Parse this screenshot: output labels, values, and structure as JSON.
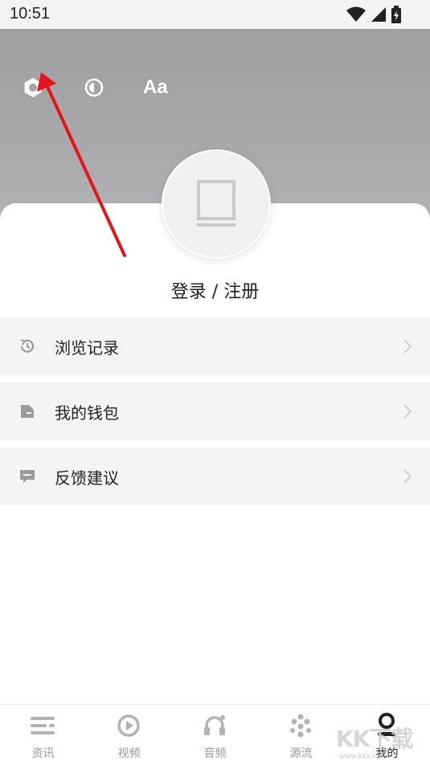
{
  "status_bar": {
    "time": "10:51",
    "icons": [
      "wifi-icon",
      "signal-icon",
      "battery-icon"
    ]
  },
  "header": {
    "icons": [
      "settings-icon",
      "theme-toggle-icon"
    ],
    "font_size_label": "Aa",
    "background_color": "#a4a4a6"
  },
  "profile": {
    "login_label": "登录 / 注册",
    "avatar_icon": "book-icon"
  },
  "menu": {
    "items": [
      {
        "label": "浏览记录",
        "icon": "history-icon"
      },
      {
        "label": "我的钱包",
        "icon": "wallet-icon"
      },
      {
        "label": "反馈建议",
        "icon": "feedback-icon"
      }
    ]
  },
  "annotation": {
    "arrow_color": "#e3141b"
  },
  "tabbar": {
    "tabs": [
      {
        "label": "资讯",
        "icon": "news-icon"
      },
      {
        "label": "视频",
        "icon": "play-icon"
      },
      {
        "label": "音频",
        "icon": "headphones-icon"
      },
      {
        "label": "源流",
        "icon": "source-icon"
      },
      {
        "label": "我的",
        "icon": "person-icon",
        "active": true
      }
    ]
  },
  "watermark": {
    "logo": "KK下载",
    "url": "www.kkx.net"
  }
}
